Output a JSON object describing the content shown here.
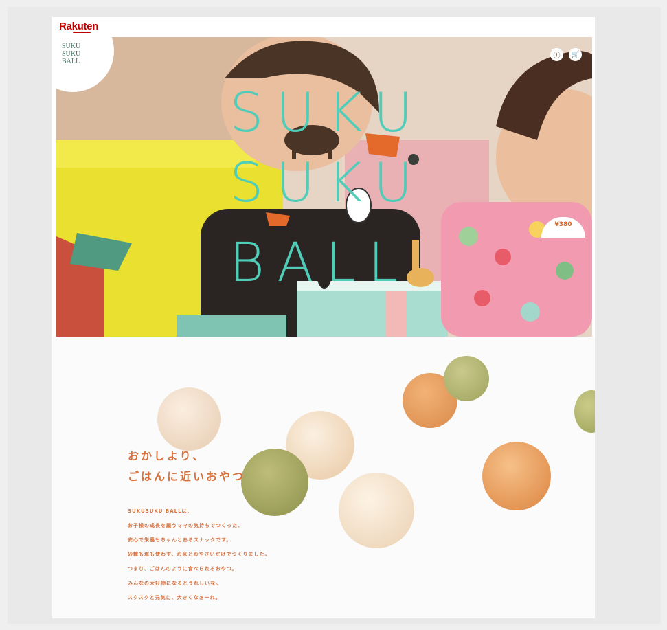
{
  "brand": {
    "name": "Rakuten"
  },
  "hero": {
    "corner_logo_text": "SUKU\nSUKU\nBALL",
    "title_lines": [
      "SUKU",
      "SUKU",
      "BALL"
    ],
    "header_icons": [
      "info-icon",
      "cart-icon"
    ],
    "price_badge": "¥380"
  },
  "copy": {
    "heading_line1": "おかしより、",
    "heading_line2": "ごはんに近いおやつ",
    "body": [
      "SUKUSUKU BALLは、",
      "お子様の成長を願うママの気持ちでつくった、",
      "安心で栄養もちゃんとあるスナックです。",
      "砂糖も塩も使わず、お米とおやさいだけでつくりました。",
      "つまり、ごはんのように食べられるおやつ。",
      "みんなの大好物になるとうれしいな。",
      "スクスクと元気に、大きくなぁーれ。"
    ]
  },
  "colors": {
    "accent_teal": "#4fcdb8",
    "accent_orange": "#d8703c",
    "rakuten_red": "#bf0000"
  }
}
